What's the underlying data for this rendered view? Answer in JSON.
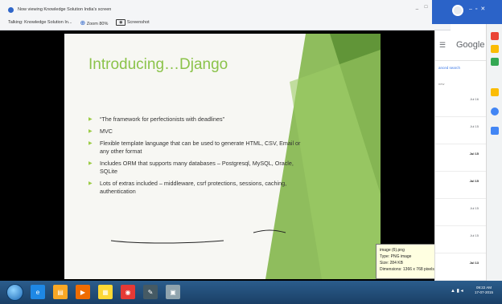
{
  "meeting_bar": {
    "viewing_text": "Now viewing Knowledge Solution India's screen",
    "talking_text": "Talking: Knowledge Solution In...",
    "zoom_label": "Zoom 80%",
    "screenshot_label": "Screenshot",
    "window_controls": "_ □ X"
  },
  "slide": {
    "title": "Introducing…Django",
    "bullets": [
      "“The framework for perfectionists with deadlines”",
      "MVC",
      "Flexible template language that can be used to generate HTML, CSV, Email or any other format",
      "Includes ORM that supports many databases – Postgresql, MySQL, Oracle, SQLite",
      "Lots of extras included – middleware, csrf protections, sessions, caching, authentication"
    ]
  },
  "image_tooltip": {
    "line1": "image (6).png",
    "line2": "Type: PNG image",
    "line3": "Size: 284 KB",
    "line4": "Dimensions: 1366 x 768 pixels"
  },
  "side_panel": {
    "brand": "Google",
    "menu_icon": "menu-icon",
    "link_text": "anced search",
    "new_text": "new",
    "mail_dates": [
      {
        "date": "Jul 16",
        "bold": false
      },
      {
        "date": "Jul 15",
        "bold": false
      },
      {
        "date": "Jul 15",
        "bold": true
      },
      {
        "date": "Jul 15",
        "bold": true
      },
      {
        "date": "Jul 15",
        "bold": false
      },
      {
        "date": "Jul 15",
        "bold": false
      },
      {
        "date": "Jul 13",
        "bold": true
      }
    ]
  },
  "taskbar": {
    "apps": [
      "ie-icon",
      "explorer-icon",
      "media-player-icon",
      "folder-icon",
      "chrome-icon",
      "paint-icon",
      "image-viewer-icon"
    ],
    "clock_time": "09:22 AM",
    "clock_date": "17-07-2015"
  },
  "colors": {
    "accent_green": "#8bc34a",
    "taskbar": "#1a3f66",
    "chrome_blue": "#2b63c8"
  }
}
